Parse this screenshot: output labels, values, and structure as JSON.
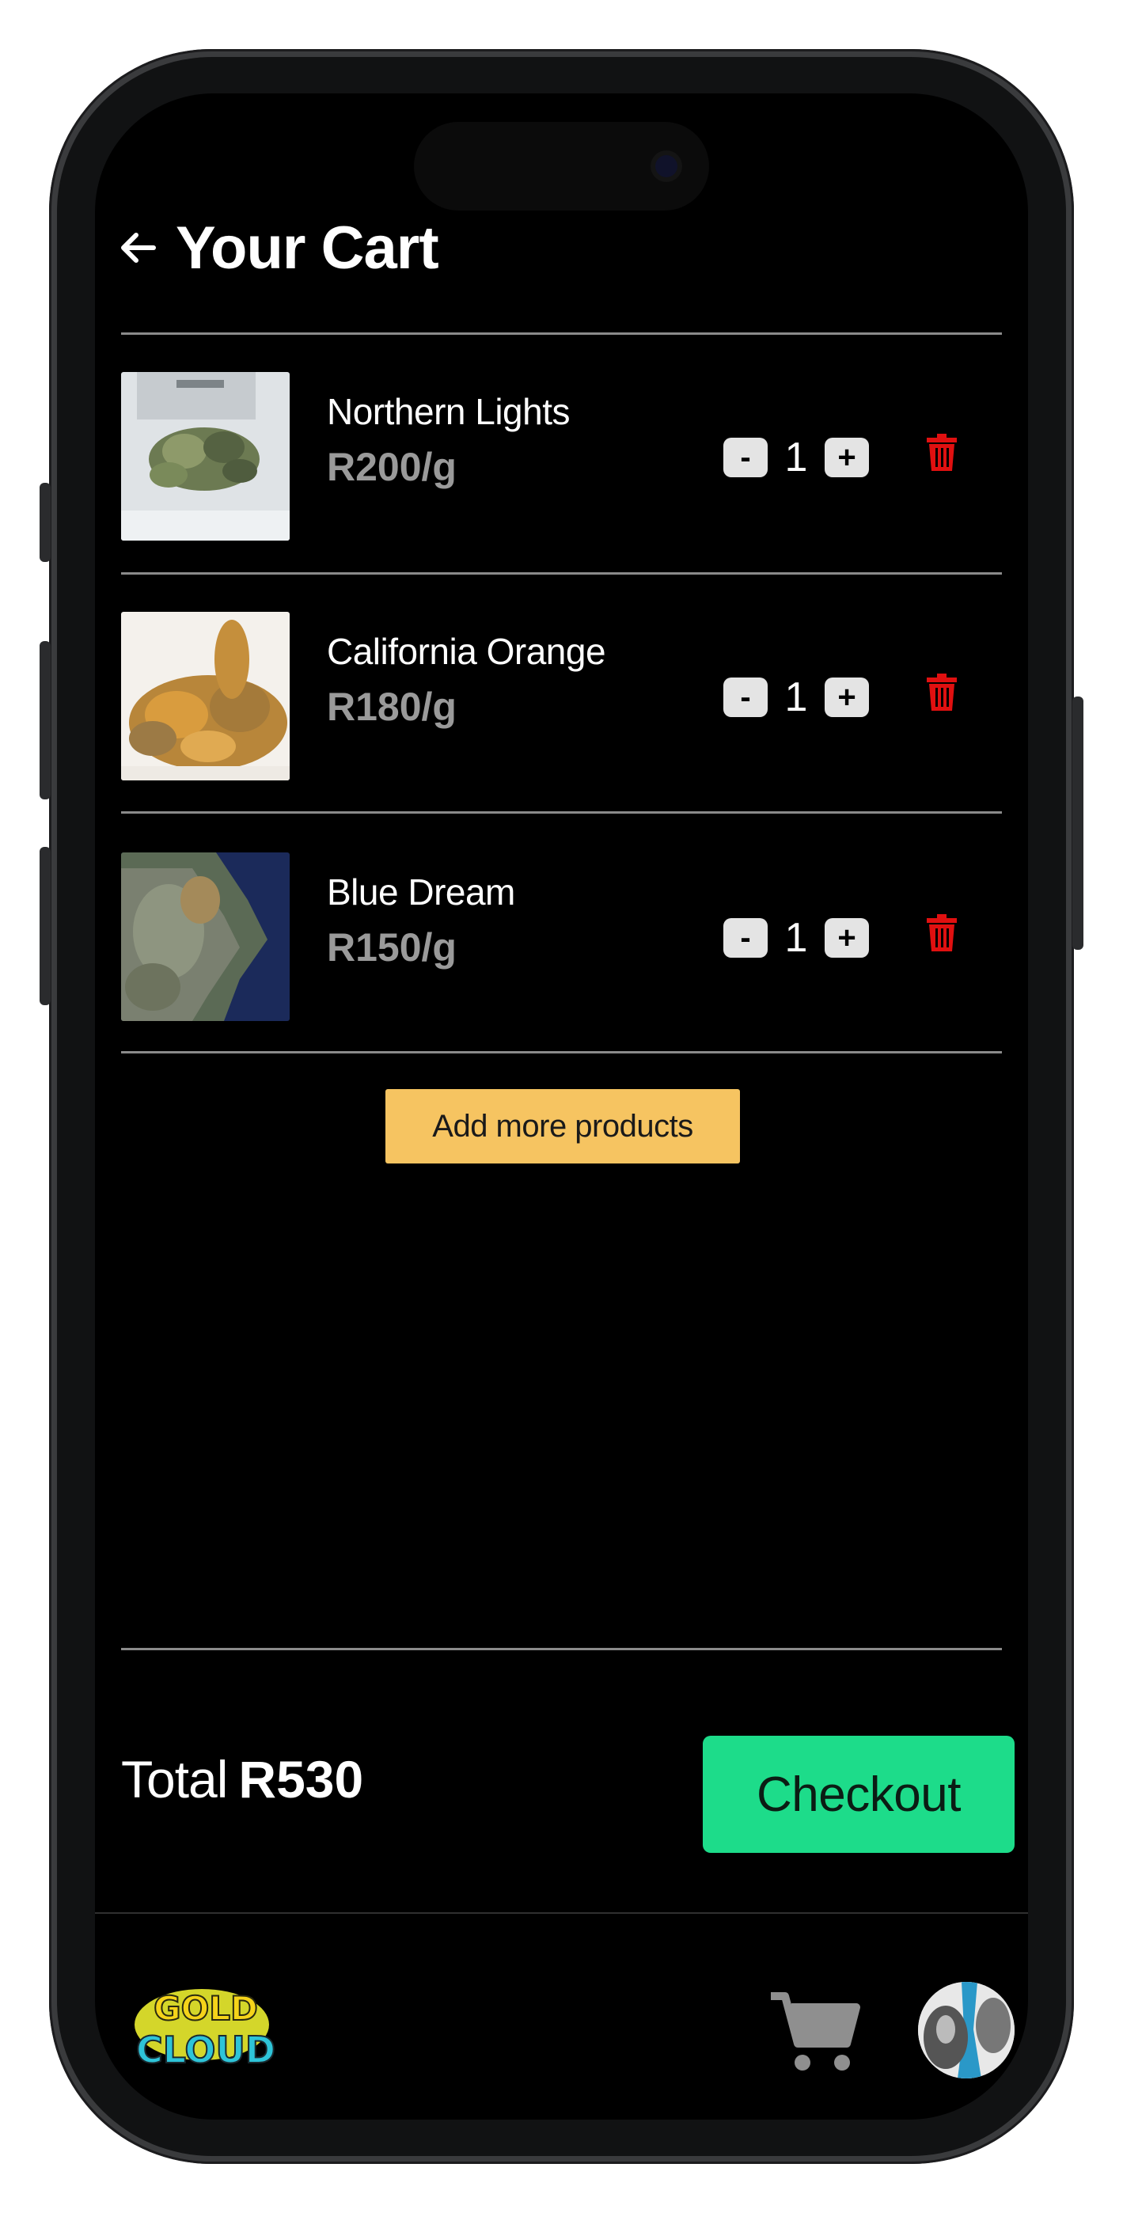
{
  "header": {
    "title": "Your Cart",
    "back_icon": "arrow-left-icon"
  },
  "cart": {
    "items": [
      {
        "name": "Northern Lights",
        "price": "R200/g",
        "quantity": "1"
      },
      {
        "name": "California Orange",
        "price": "R180/g",
        "quantity": "1"
      },
      {
        "name": "Blue Dream",
        "price": "R150/g",
        "quantity": "1"
      }
    ],
    "decrement_label": "-",
    "increment_label": "+",
    "delete_icon": "trash-icon",
    "add_more_label": "Add more products"
  },
  "summary": {
    "total_label": "Total",
    "total_value": "R530",
    "checkout_label": "Checkout"
  },
  "nav": {
    "logo_text": [
      "GOLD",
      "CLOUD"
    ],
    "cart_icon": "cart-icon",
    "avatar_icon": "profile-avatar"
  },
  "colors": {
    "background": "#000000",
    "accent_yellow": "#f6c461",
    "checkout_green": "#1ddc8a",
    "delete_red": "#e01010",
    "price_gray": "#9a9a9a"
  }
}
